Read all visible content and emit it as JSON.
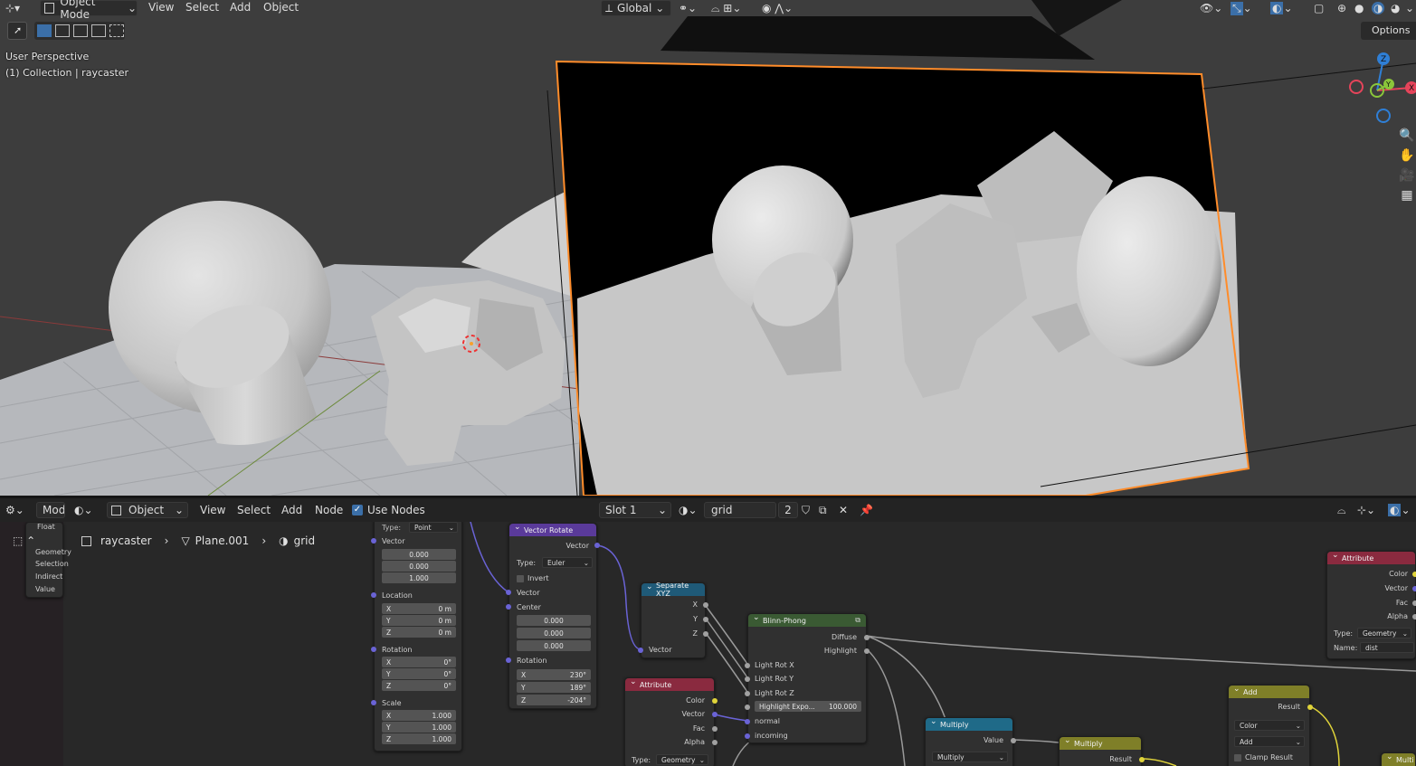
{
  "viewport_header": {
    "mode": "Object Mode",
    "menus": [
      "View",
      "Select",
      "Add",
      "Object"
    ],
    "transform_orientation": "Global",
    "options_label": "Options"
  },
  "viewport_overlay": {
    "perspective": "User Perspective",
    "collection": "(1) Collection | raycaster"
  },
  "gizmo": {
    "z": "Z",
    "y": "Y",
    "x": "X"
  },
  "node_header": {
    "editor_mode": "Mod",
    "object_label": "Object",
    "menus": [
      "View",
      "Select",
      "Add",
      "Node"
    ],
    "use_nodes_label": "Use Nodes",
    "slot": "Slot 1",
    "material_name": "grid",
    "users": "2"
  },
  "breadcrumb": {
    "object": "raycaster",
    "mesh": "Plane.001",
    "material": "grid"
  },
  "left_node": {
    "float_label": "Float",
    "rows": [
      "Geometry",
      "Selection",
      "Indirect",
      "Value"
    ]
  },
  "mapping_node": {
    "type_label": "Type:",
    "type_value": "Point",
    "vector_label": "Vector",
    "vector_values": [
      "0.000",
      "0.000",
      "1.000"
    ],
    "location_label": "Location",
    "location": [
      [
        "X",
        "0 m"
      ],
      [
        "Y",
        "0 m"
      ],
      [
        "Z",
        "0 m"
      ]
    ],
    "rotation_label": "Rotation",
    "rotation": [
      [
        "X",
        "0°"
      ],
      [
        "Y",
        "0°"
      ],
      [
        "Z",
        "0°"
      ]
    ],
    "scale_label": "Scale",
    "scale": [
      [
        "X",
        "1.000"
      ],
      [
        "Y",
        "1.000"
      ],
      [
        "Z",
        "1.000"
      ]
    ]
  },
  "vector_rotate": {
    "title": "Vector Rotate",
    "out_vector": "Vector",
    "type_label": "Type:",
    "type_value": "Euler",
    "invert_label": "Invert",
    "vector_label": "Vector",
    "center_label": "Center",
    "center_values": [
      "0.000",
      "0.000",
      "0.000"
    ],
    "rotation_label": "Rotation",
    "rotation": [
      [
        "X",
        "230°"
      ],
      [
        "Y",
        "189°"
      ],
      [
        "Z",
        "-204°"
      ]
    ]
  },
  "separate_xyz": {
    "title": "Separate XYZ",
    "outputs": [
      "X",
      "Y",
      "Z"
    ],
    "input": "Vector"
  },
  "attribute_node": {
    "title": "Attribute",
    "outputs": [
      "Color",
      "Vector",
      "Fac",
      "Alpha"
    ],
    "type_label": "Type:",
    "type_value": "Geometry"
  },
  "blinn_phong": {
    "title": "Blinn-Phong",
    "outputs": [
      "Diffuse",
      "Highlight"
    ],
    "inputs": [
      "Light Rot X",
      "Light Rot Y",
      "Light Rot Z"
    ],
    "exponent_label": "Highlight Expo...",
    "exponent_value": "100.000",
    "normal_label": "normal",
    "incoming_label": "incoming"
  },
  "multiply1": {
    "title": "Multiply",
    "output": "Value",
    "operation": "Multiply"
  },
  "multiply2": {
    "title": "Multiply",
    "output": "Result"
  },
  "add_node": {
    "title": "Add",
    "output": "Result",
    "blend": "Color",
    "mode": "Add",
    "clamp_label": "Clamp Result"
  },
  "attribute_right": {
    "title": "Attribute",
    "outputs": [
      "Color",
      "Vector",
      "Fac",
      "Alpha"
    ],
    "type_label": "Type:",
    "type_value": "Geometry",
    "name_label": "Name:",
    "name_value": "dist"
  },
  "multiply_edge": {
    "title": "Multi"
  },
  "colors": {
    "selection_outline": "#ff8c2a",
    "viewport_bg": "#3d3d3d",
    "node_editor_bg": "#282828",
    "axis_x": "#e5445a",
    "axis_y": "#8bc63a",
    "axis_z": "#2f7fd6"
  }
}
